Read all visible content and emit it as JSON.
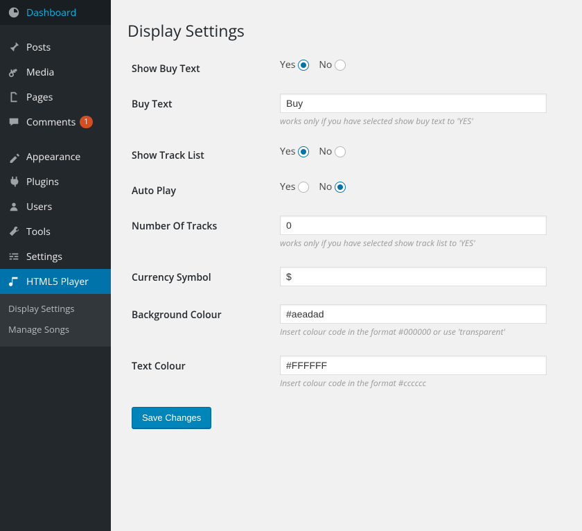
{
  "sidebar": {
    "items": [
      {
        "label": "Dashboard",
        "icon": "dashboard"
      },
      {
        "label": "Posts",
        "icon": "pin"
      },
      {
        "label": "Media",
        "icon": "media"
      },
      {
        "label": "Pages",
        "icon": "pages"
      },
      {
        "label": "Comments",
        "icon": "comments",
        "badge": "1"
      },
      {
        "label": "Appearance",
        "icon": "appearance"
      },
      {
        "label": "Plugins",
        "icon": "plugins"
      },
      {
        "label": "Users",
        "icon": "users"
      },
      {
        "label": "Tools",
        "icon": "tools"
      },
      {
        "label": "Settings",
        "icon": "settings"
      },
      {
        "label": "HTML5 Player",
        "icon": "music",
        "active": true
      }
    ],
    "submenu": [
      {
        "label": "Display Settings"
      },
      {
        "label": "Manage Songs"
      }
    ]
  },
  "page": {
    "title": "Display Settings"
  },
  "form": {
    "show_buy_text": {
      "label": "Show Buy Text",
      "yes": "Yes",
      "no": "No",
      "value": "yes"
    },
    "buy_text": {
      "label": "Buy Text",
      "value": "Buy",
      "help": "works only if you have selected show buy text to 'YES'"
    },
    "show_track_list": {
      "label": "Show Track List",
      "yes": "Yes",
      "no": "No",
      "value": "yes"
    },
    "auto_play": {
      "label": "Auto Play",
      "yes": "Yes",
      "no": "No",
      "value": "no"
    },
    "number_of_tracks": {
      "label": "Number Of Tracks",
      "value": "0",
      "help": "works only if you have selected show track list to 'YES'"
    },
    "currency_symbol": {
      "label": "Currency Symbol",
      "value": "$"
    },
    "background_colour": {
      "label": "Background Colour",
      "value": "#aeadad",
      "help": "Insert colour code in the format #000000 or use 'transparent'"
    },
    "text_colour": {
      "label": "Text Colour",
      "value": "#FFFFFF",
      "help": "Insert colour code in the format #cccccc"
    },
    "save": "Save Changes"
  }
}
